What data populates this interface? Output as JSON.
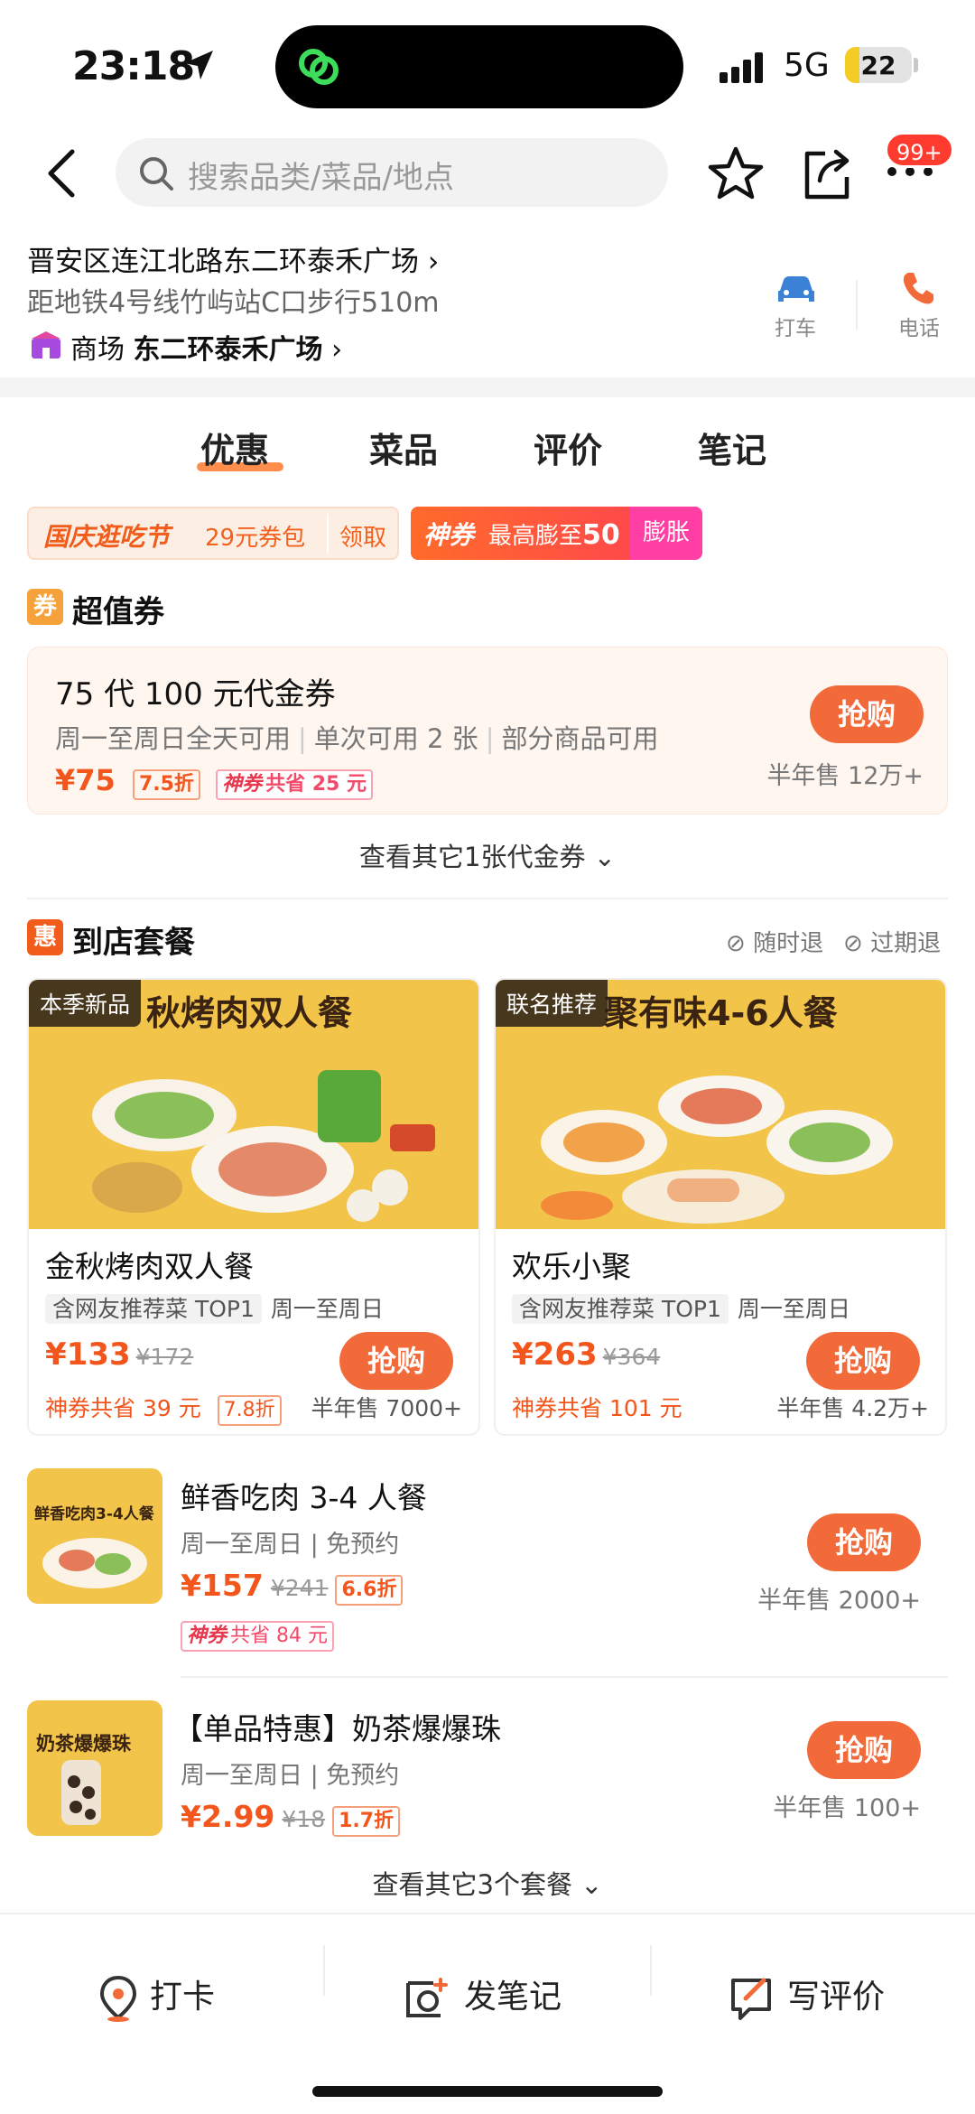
{
  "status": {
    "time": "23:18",
    "network": "5G",
    "battery": "22"
  },
  "header": {
    "search_placeholder": "搜索品类/菜品/地点",
    "badge": "99+"
  },
  "shop": {
    "address": "晋安区连江北路东二环泰禾广场",
    "distance": "距地铁4号线竹屿站C口步行510m",
    "mall_prefix": "商场",
    "mall_name": "东二环泰禾广场",
    "actions": {
      "taxi": "打车",
      "phone": "电话"
    }
  },
  "tabs": [
    "优惠",
    "菜品",
    "评价",
    "笔记"
  ],
  "promos": {
    "festival_title": "国庆逛吃节",
    "festival_sub": "29元券包",
    "festival_btn": "领取",
    "shen_title": "神券",
    "shen_sub_prefix": "最高膨至",
    "shen_sub_value": "50",
    "shen_btn": "膨胀"
  },
  "voucher_section": {
    "icon": "券",
    "title": "超值券",
    "voucher": {
      "title": "75 代 100 元代金券",
      "desc1": "周一至周日全天可用",
      "desc2": "单次可用 2 张",
      "desc3": "部分商品可用",
      "price": "¥75",
      "discount": "7.5折",
      "shen_label": "神券",
      "saving": "共省 25 元",
      "buy": "抢购",
      "sold": "半年售 12万+"
    },
    "see_more": "查看其它1张代金券"
  },
  "package_section": {
    "icon": "惠",
    "title": "到店套餐",
    "flag1": "随时退",
    "flag2": "过期退",
    "cards": [
      {
        "tag": "本季新品",
        "banner": "秋烤肉双人餐",
        "title": "金秋烤肉双人餐",
        "chip": "含网友推荐菜 TOP1",
        "days": "周一至周日",
        "price": "¥133",
        "orig": "¥172",
        "buy": "抢购",
        "saving": "神券共省 39 元",
        "discount": "7.8折",
        "sold": "半年售 7000+"
      },
      {
        "tag": "联名推荐",
        "banner": "聚有味4-6人餐",
        "title": "欢乐小聚",
        "chip": "含网友推荐菜 TOP1",
        "days": "周一至周日",
        "price": "¥263",
        "orig": "¥364",
        "buy": "抢购",
        "saving": "神券共省 101 元",
        "sold": "半年售 4.2万+"
      }
    ],
    "rows": [
      {
        "thumb_text": "鲜香吃肉3-4人餐",
        "title": "鲜香吃肉 3-4 人餐",
        "sub": "周一至周日 | 免预约",
        "price": "¥157",
        "orig": "¥241",
        "discount": "6.6折",
        "shen_label": "神券",
        "saving": "共省 84 元",
        "buy": "抢购",
        "sold": "半年售 2000+"
      },
      {
        "thumb_text": "奶茶爆爆珠",
        "title": "【单品特惠】奶茶爆爆珠",
        "sub": "周一至周日 | 免预约",
        "price": "¥2.99",
        "orig": "¥18",
        "discount": "1.7折",
        "buy": "抢购",
        "sold": "半年售 100+"
      }
    ],
    "see_more": "查看其它3个套餐"
  },
  "bottom_bar": {
    "checkin": "打卡",
    "note": "发笔记",
    "review": "写评价"
  }
}
